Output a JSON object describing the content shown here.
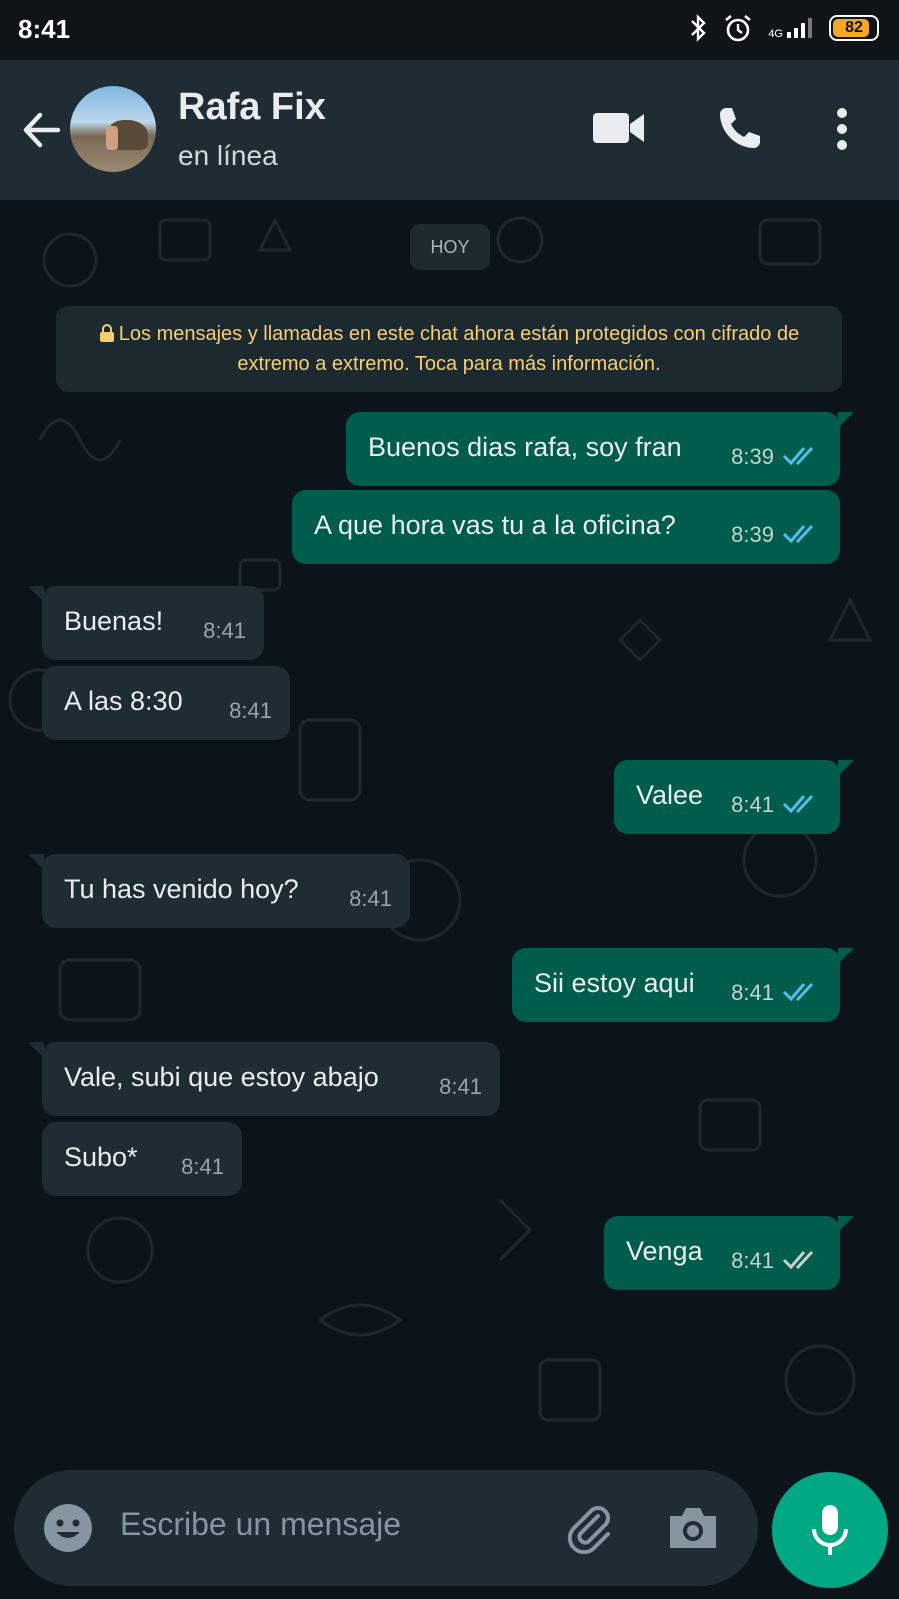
{
  "status_bar": {
    "time": "8:41",
    "battery": "82",
    "network": "4G"
  },
  "header": {
    "contact_name": "Rafa Fix",
    "contact_status": "en línea",
    "icons": [
      "back-arrow-icon",
      "video-call-icon",
      "phone-icon",
      "more-vert-icon"
    ]
  },
  "chat": {
    "date_chip": "HOY",
    "encryption_notice": "Los mensajes y llamadas en este chat ahora están protegidos con cifrado de extremo a extremo. Toca para más información.",
    "messages": [
      {
        "direction": "out",
        "text": "Buenos dias rafa, soy fran",
        "time": "8:39",
        "status": "read"
      },
      {
        "direction": "out",
        "text": "A que hora vas tu a la oficina?",
        "time": "8:39",
        "status": "read"
      },
      {
        "direction": "in",
        "text": "Buenas!",
        "time": "8:41"
      },
      {
        "direction": "in",
        "text": "A las 8:30",
        "time": "8:41"
      },
      {
        "direction": "out",
        "text": "Valee",
        "time": "8:41",
        "status": "read"
      },
      {
        "direction": "in",
        "text": "Tu has venido hoy?",
        "time": "8:41"
      },
      {
        "direction": "out",
        "text": "Sii estoy aqui",
        "time": "8:41",
        "status": "read"
      },
      {
        "direction": "in",
        "text": "Vale, subi que estoy abajo",
        "time": "8:41"
      },
      {
        "direction": "in",
        "text": "Subo*",
        "time": "8:41"
      },
      {
        "direction": "out",
        "text": "Venga",
        "time": "8:41",
        "status": "delivered"
      }
    ]
  },
  "composer": {
    "placeholder": "Escribe un mensaje",
    "icons": [
      "emoji-icon",
      "attach-icon",
      "camera-icon",
      "mic-icon"
    ]
  },
  "colors": {
    "outgoing_bubble": "#005c4b",
    "incoming_bubble": "#1f2c34",
    "read_ticks": "#53bdeb",
    "delivered_ticks": "#c7d1d0",
    "accent": "#00a884",
    "notice_text": "#f7cd73"
  }
}
